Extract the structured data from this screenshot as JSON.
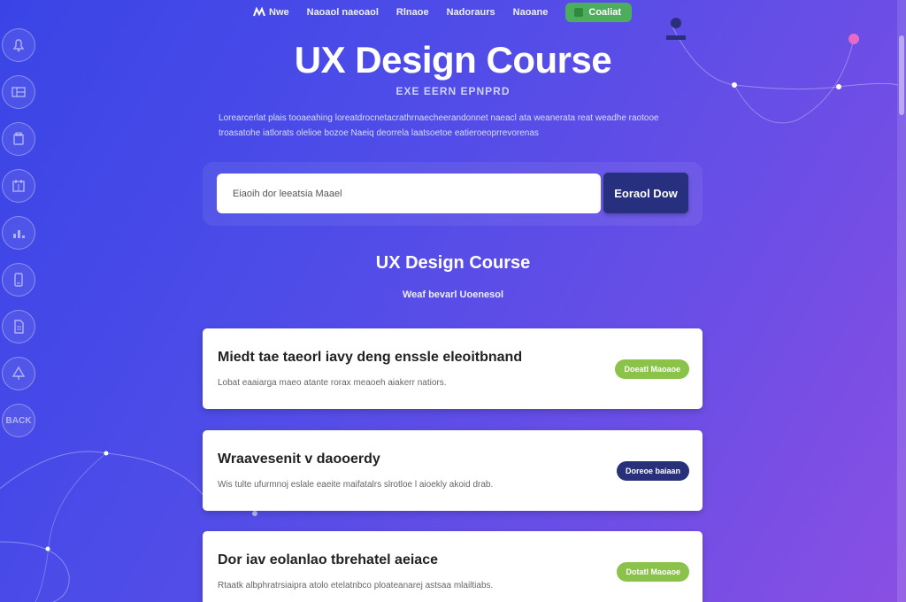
{
  "nav": {
    "items": [
      {
        "label": "Nwe"
      },
      {
        "label": "Naoaol naeoaol"
      },
      {
        "label": "Rlnaoe"
      },
      {
        "label": "Nadoraurs"
      },
      {
        "label": "Naoane"
      }
    ],
    "cta_label": "Coaliat"
  },
  "rail": {
    "items": [
      {
        "icon": "bell-icon"
      },
      {
        "icon": "layout-icon"
      },
      {
        "icon": "page-icon"
      },
      {
        "icon": "calendar-icon"
      },
      {
        "icon": "chart-icon"
      },
      {
        "icon": "phone-icon"
      },
      {
        "icon": "document-icon"
      },
      {
        "icon": "tree-icon"
      },
      {
        "icon": "back-icon",
        "label": "BACK"
      }
    ]
  },
  "hero": {
    "title": "UX Design Course",
    "subtitle": "EXE EERN EPNPRD",
    "description": "Lorearcerlat plais tooaeahing loreatdrocnetacrathrnaecheerandonnet naeacl ata weanerata reat weadhe raotooe troasatohe iatlorats olelioe bozoe Naeiq deorrela laatsoetoe eatieroeoprrevorenas"
  },
  "search": {
    "placeholder": "Eiaoih dor leeatsia Maael",
    "button_label": "Eoraol Dow"
  },
  "section": {
    "title": "UX Design Course",
    "subtitle": "Weaf bevarl Uoenesol"
  },
  "cards": [
    {
      "title": "Miedt tae taeorl iavy deng enssle eleoitbnand",
      "desc": "Lobat eaaiarga maeo atante rorax meaoeh aiakerr natiors.",
      "button_label": "Doeatl Maoaoe"
    },
    {
      "title": "Wraavesenit v daooerdy",
      "desc": "Wis tulte ufurmnoj eslale eaeite maifatalrs slrotloe l aioekly akoid drab.",
      "button_label": "Doreoe baiaan"
    },
    {
      "title": "Dor iav eolanlao tbrehatel aeiace",
      "desc": "Rtaatk albphratrsiaipra atolo etelatnbco ploateanarej astsaa mlailtiabs.",
      "button_label": "Dotatl Maoaoe"
    }
  ],
  "colors": {
    "bg_start": "#3a44e6",
    "bg_end": "#8a4fe3",
    "cta_green": "#4cae5c",
    "button_green": "#8bc34a",
    "button_navy": "#28307a",
    "search_button": "#27307e"
  }
}
